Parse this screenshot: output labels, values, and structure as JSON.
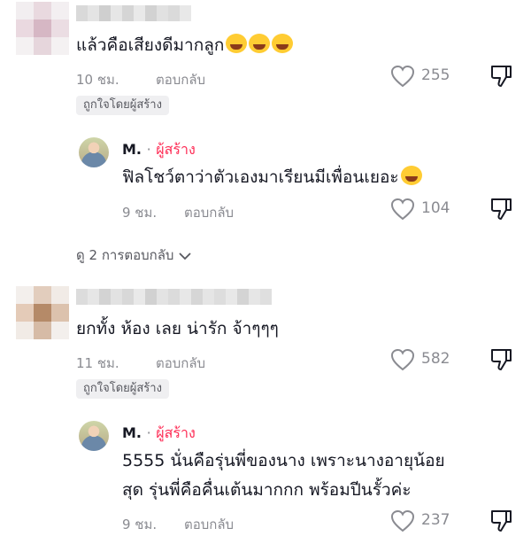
{
  "comments": [
    {
      "text": "แล้วคือเสียงดีมากลูก",
      "emoji_count": 3,
      "time": "10 ชม.",
      "reply_label": "ตอบกลับ",
      "likes": "255",
      "badge": "ถูกใจโดยผู้สร้าง",
      "reply": {
        "author": "M.",
        "separator": "·",
        "creator_label": "ผู้สร้าง",
        "text": "ฟิลโชว์ตาว่าตัวเองมาเรียนมีเพื่อนเยอะ",
        "time": "9 ชม.",
        "reply_label": "ตอบกลับ",
        "likes": "104"
      },
      "view_more": "ดู 2 การตอบกลับ"
    },
    {
      "text": "ยกทั้ง ห้อง เลย น่ารัก จ้าๆๆๆ",
      "time": "11 ชม.",
      "reply_label": "ตอบกลับ",
      "likes": "582",
      "badge": "ถูกใจโดยผู้สร้าง",
      "reply": {
        "author": "M.",
        "separator": "·",
        "creator_label": "ผู้สร้าง",
        "text_line1": "5555 นั่นคือรุ่นพี่ของนาง เพราะนางอายุน้อย",
        "text_line2": "สุด รุ่นพี่คือคื่นเต้นมากกก พร้อมปีนรั้วค่ะ",
        "time": "9 ชม.",
        "reply_label": "ตอบกลับ",
        "likes": "237"
      }
    }
  ],
  "icons": {
    "like": "heart-outline-icon",
    "dislike": "thumbs-down-icon",
    "expand": "chevron-down-icon"
  },
  "colors": {
    "creator": "#fe2c55",
    "muted": "#8a8b91",
    "badge_bg": "#efeff1"
  }
}
